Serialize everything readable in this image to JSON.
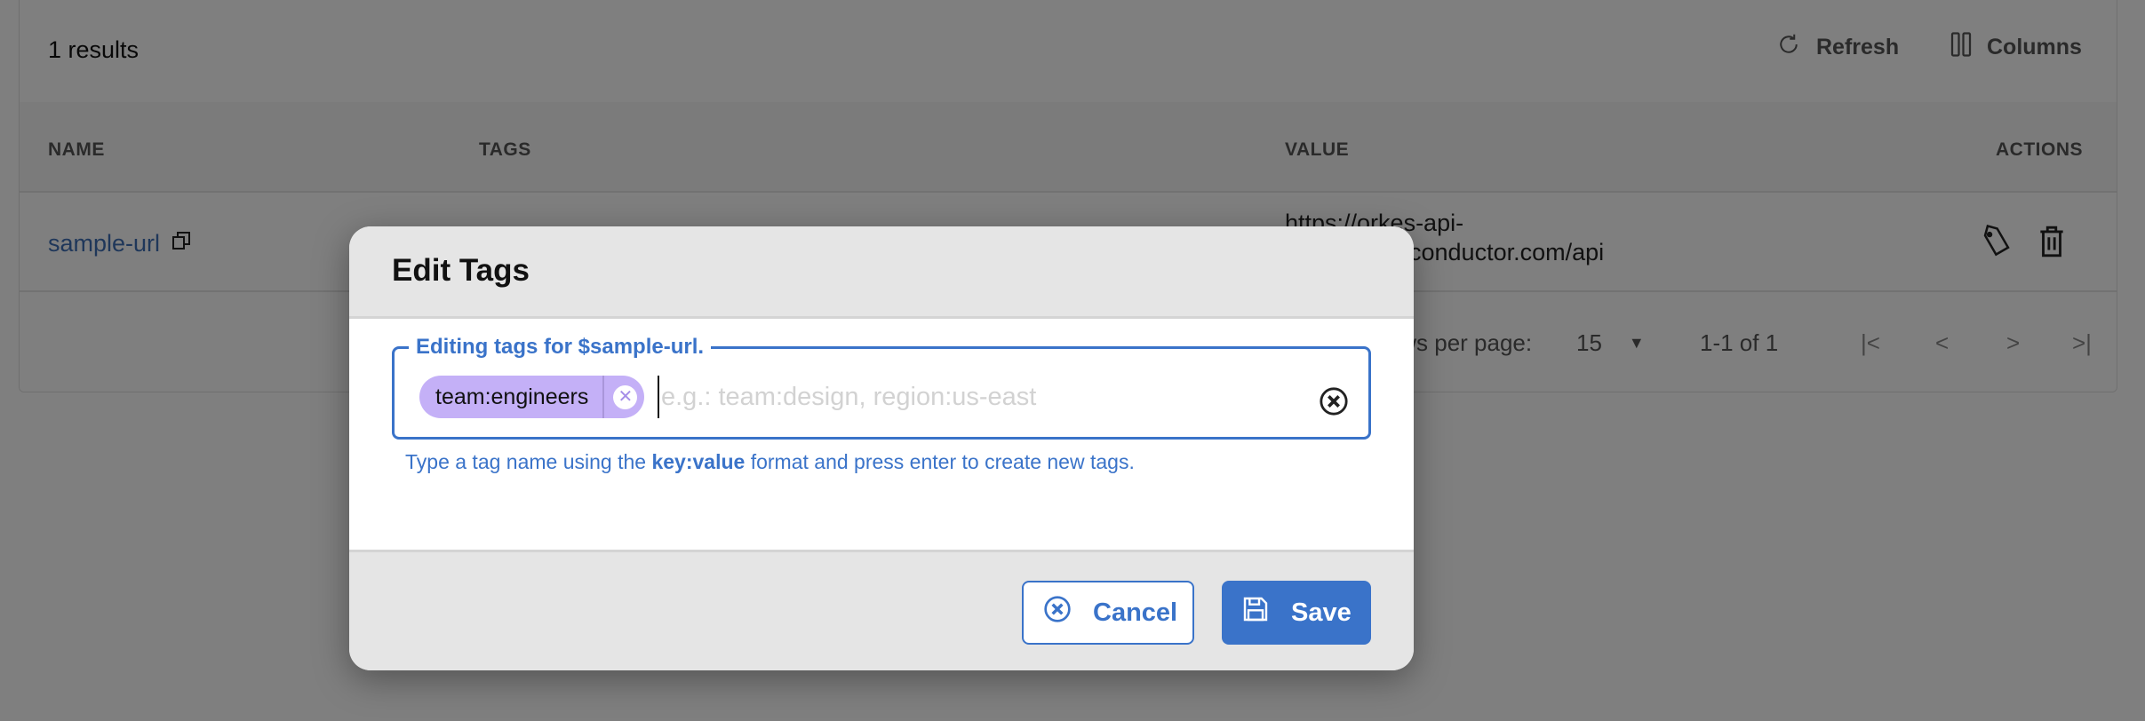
{
  "toolbar": {
    "results_label": "1 results",
    "refresh_label": "Refresh",
    "columns_label": "Columns"
  },
  "table": {
    "columns": [
      "NAME",
      "TAGS",
      "VALUE",
      "ACTIONS"
    ],
    "rows": [
      {
        "name": "sample-url",
        "tags": [],
        "value_line1": "https://orkes-api-",
        "value_line2": "conductor.com/api"
      }
    ]
  },
  "pagination": {
    "rows_per_page_label": "Rows per page:",
    "rows_per_page_value": "15",
    "range_label": "1-1 of 1"
  },
  "modal": {
    "title": "Edit Tags",
    "field_legend": "Editing tags for $sample-url.",
    "tags": [
      {
        "label": "team:engineers"
      }
    ],
    "input_value": "",
    "input_placeholder": "e.g.: team:design, region:us-east",
    "helper_prefix": "Type a tag name using the ",
    "helper_bold": "key:value",
    "helper_suffix": " format and press enter to create new tags.",
    "cancel_label": "Cancel",
    "save_label": "Save"
  },
  "colors": {
    "accent": "#3a73c9",
    "chip_bg": "#c4b0f7",
    "link": "#3f6fb5",
    "overlay": "rgba(0,0,0,0.5)"
  }
}
